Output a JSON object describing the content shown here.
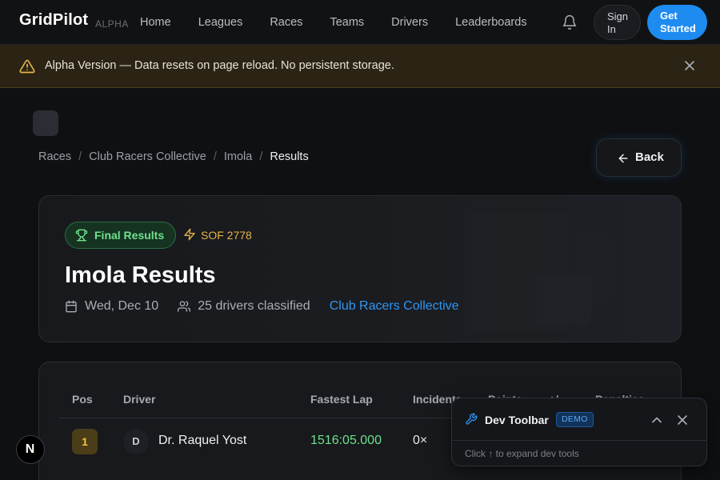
{
  "nav": {
    "logo": "GridPilot",
    "alpha_tag": "ALPHA",
    "links": [
      "Home",
      "Leagues",
      "Races",
      "Teams",
      "Drivers",
      "Leaderboards"
    ],
    "notifications_icon": "bell-icon",
    "sign_in": "Sign In",
    "get_started": "Get Started"
  },
  "banner": {
    "icon": "warning-icon",
    "text": "Alpha Version — Data resets on page reload. No persistent storage.",
    "close_icon": "close-icon"
  },
  "breadcrumb": {
    "items": [
      "Races",
      "Club Racers Collective",
      "Imola"
    ],
    "current": "Results",
    "separator": "/"
  },
  "back_button": {
    "label": "Back",
    "icon": "arrow-left-icon"
  },
  "hero": {
    "badge": "Final Results",
    "badge_icon": "trophy-icon",
    "sof": "SOF 2778",
    "sof_icon": "lightning-icon",
    "title": "Imola Results",
    "date": "Wed, Dec 10",
    "drivers": "25 drivers classified",
    "league": "Club Racers Collective"
  },
  "results": {
    "columns": [
      "Pos",
      "Driver",
      "Fastest Lap",
      "Incidents",
      "Points",
      "+/-",
      "Penalties"
    ],
    "rows": [
      {
        "pos": "1",
        "avatar": "D",
        "driver": "Dr. Raquel Yost",
        "fastest_lap": "1516:05.000",
        "incidents": "0×"
      }
    ]
  },
  "dev_toolbar": {
    "title": "Dev Toolbar",
    "badge": "DEMO",
    "hint": "Click ↑ to expand dev tools",
    "icon": "wrench-icon"
  },
  "floating_button": {
    "label": "N"
  },
  "colors": {
    "accent": "#1e8bf0",
    "success": "#6fe08c",
    "warning": "#e6b44a",
    "gold": "#f2c23a"
  }
}
